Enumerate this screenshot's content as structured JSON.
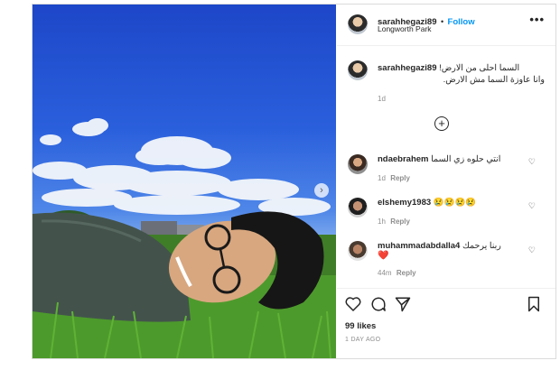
{
  "post": {
    "username": "sarahhegazi89",
    "follow_label": "Follow",
    "separator": "•",
    "location": "Longworth Park",
    "more_label": "•••",
    "caption_line1": "السما احلى من الارض!",
    "caption_line2": "وانا عاوزة السما مش الارض.",
    "caption_time": "1d",
    "load_more_label": "+"
  },
  "comments": [
    {
      "username": "ndaebrahem",
      "text": "انتي حلوه زي السما",
      "time": "1d",
      "reply": "Reply"
    },
    {
      "username": "elshemy1983",
      "text": "😢😢😢😢",
      "time": "1h",
      "reply": "Reply"
    },
    {
      "username": "muhammadabdalla4",
      "text": "ربنا يرحمك",
      "extra": "❤️",
      "time": "44m",
      "reply": "Reply"
    }
  ],
  "footer": {
    "likes": "99 likes",
    "time_ago": "1 DAY AGO"
  },
  "photo": {
    "next_label": "›"
  },
  "icons": {
    "heart": "heart-icon",
    "comment": "comment-icon",
    "share": "share-icon",
    "bookmark": "bookmark-icon"
  }
}
